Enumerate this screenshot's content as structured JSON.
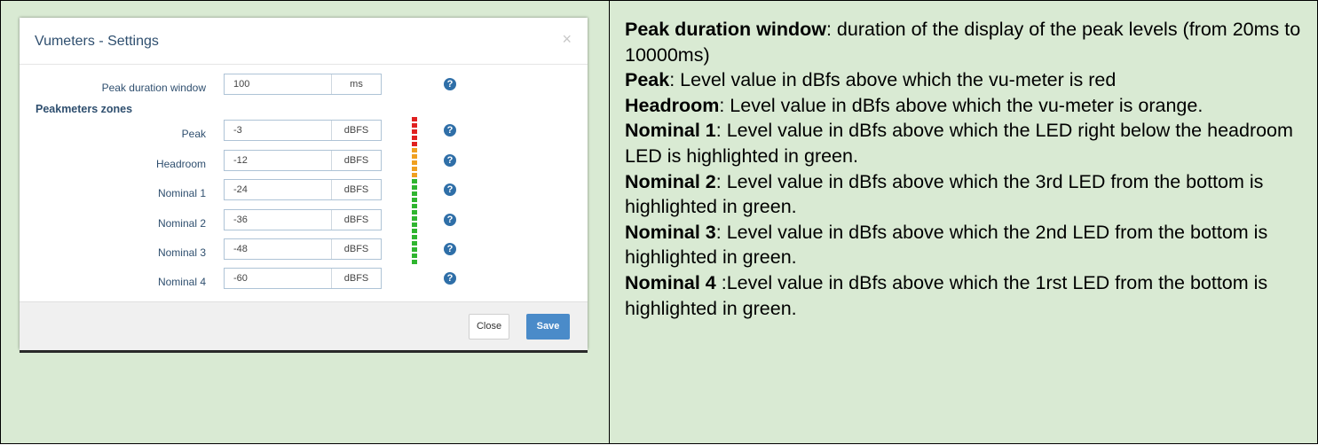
{
  "modal": {
    "title": "Vumeters - Settings",
    "close_glyph": "×",
    "peak_duration": {
      "label": "Peak duration window",
      "value": "100",
      "unit": "ms"
    },
    "section_title": "Peakmeters zones",
    "zones": [
      {
        "label": "Peak",
        "value": "-3",
        "unit": "dBFS"
      },
      {
        "label": "Headroom",
        "value": "-12",
        "unit": "dBFS"
      },
      {
        "label": "Nominal 1",
        "value": "-24",
        "unit": "dBFS"
      },
      {
        "label": "Nominal 2",
        "value": "-36",
        "unit": "dBFS"
      },
      {
        "label": "Nominal 3",
        "value": "-48",
        "unit": "dBFS"
      },
      {
        "label": "Nominal 4",
        "value": "-60",
        "unit": "dBFS"
      }
    ],
    "help_glyph": "?",
    "led_colors": {
      "red": "#e02020",
      "orange": "#f0a020",
      "green": "#2fb52f"
    },
    "footer": {
      "close_label": "Close",
      "save_label": "Save"
    }
  },
  "description": [
    {
      "term": "Peak duration window",
      "sep": ": ",
      "text": "duration of the display of the peak levels (from 20ms to 10000ms)"
    },
    {
      "term": "Peak",
      "sep": ": ",
      "text": "Level value in dBfs above which the vu-meter is red"
    },
    {
      "term": "Headroom",
      "sep": ": ",
      "text": "Level value in dBfs above which the vu-meter is orange."
    },
    {
      "term": "Nominal 1",
      "sep": ": ",
      "text": "Level value in dBfs above which the LED right below the headroom LED is highlighted in green."
    },
    {
      "term": "Nominal 2",
      "sep": ": ",
      "text": "Level value in dBfs above which the 3rd LED from the bottom is highlighted in green."
    },
    {
      "term": "Nominal 3",
      "sep": ": ",
      "text": "Level value in dBfs above which the 2nd LED from the bottom is highlighted in green."
    },
    {
      "term": "Nominal 4",
      "sep": " :",
      "text": "Level value in dBfs above which the 1rst LED from the bottom is highlighted in green."
    }
  ]
}
